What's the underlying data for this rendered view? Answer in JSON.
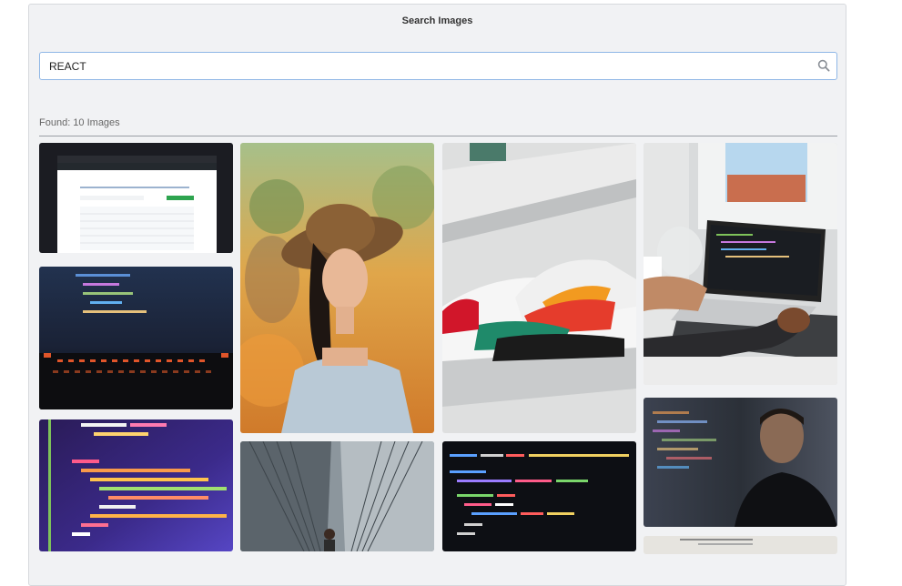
{
  "header": {
    "title": "Search Images"
  },
  "search": {
    "value": "REACT",
    "placeholder": ""
  },
  "results": {
    "found_label": "Found: 10 Images"
  },
  "images": [
    {
      "subject": "github-repository-screenshot"
    },
    {
      "subject": "woman-with-hat"
    },
    {
      "subject": "nike-sneakers-on-shelf"
    },
    {
      "subject": "person-typing-on-laptop"
    },
    {
      "subject": "code-on-monitor-keyboard"
    },
    {
      "subject": "react-jsx-code-screen"
    },
    {
      "subject": "man-in-glass-building"
    },
    {
      "subject": "javascript-fetch-code"
    },
    {
      "subject": "man-with-code-reflection"
    },
    {
      "subject": "partially-visible-image"
    }
  ]
}
